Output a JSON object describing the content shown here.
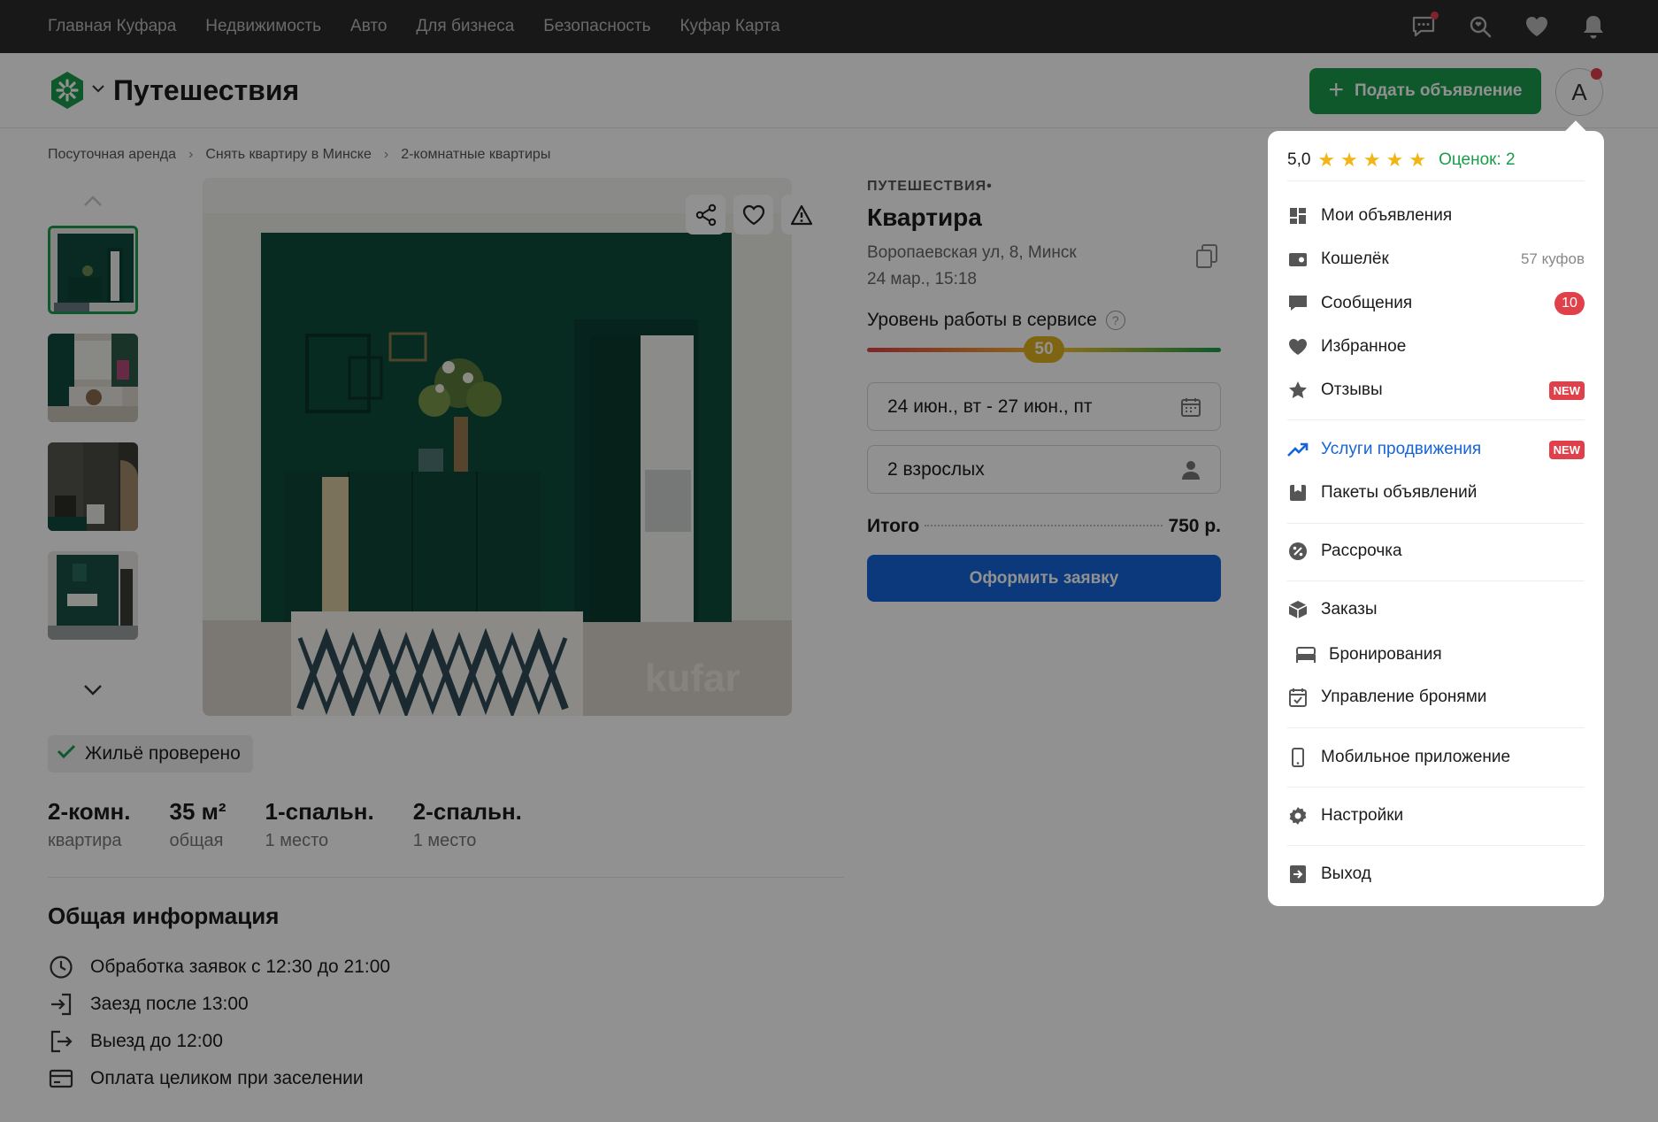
{
  "topnav": {
    "links": [
      "Главная Куфара",
      "Недвижимость",
      "Авто",
      "Для бизнеса",
      "Безопасность",
      "Куфар Карта"
    ],
    "icons": [
      "messages-icon",
      "saved-search-icon",
      "heart-icon",
      "bell-icon"
    ]
  },
  "header": {
    "section_title": "Путешествия",
    "post_button": "Подать объявление",
    "avatar_letter": "А"
  },
  "breadcrumb": [
    "Посуточная аренда",
    "Снять квартиру в Минске",
    "2-комнатные квартиры"
  ],
  "gallery": {
    "thumbnail_count": 4,
    "watermark": "kufar"
  },
  "verified_label": "Жильё проверено",
  "specs": [
    {
      "value": "2-комн.",
      "label": "квартира"
    },
    {
      "value": "35 м²",
      "label": "общая"
    },
    {
      "value": "1-спальн.",
      "label": "1 место"
    },
    {
      "value": "2-спальн.",
      "label": "1 место"
    }
  ],
  "general_info": {
    "title": "Общая информация",
    "rows": [
      "Обработка заявок с 12:30 до 21:00",
      "Заезд после 13:00",
      "Выезд до 12:00",
      "Оплата целиком при заселении"
    ]
  },
  "listing": {
    "category": "ПУТЕШЕСТВИЯ•",
    "title": "Квартира",
    "address": "Воропаевская ул, 8, Минск",
    "date": "24 мар., 15:18",
    "service_level_label": "Уровень работы в сервисе",
    "service_level_value": "50",
    "service_level_fraction": 0.5,
    "dates_field": "24 июн., вт - 27 июн., пт",
    "guests_field": "2 взрослых",
    "total_label": "Итого",
    "total_value": "750 р.",
    "order_button": "Оформить заявку"
  },
  "menu": {
    "rating_value": "5,0",
    "stars": 5,
    "rating_count": "Оценок: 2",
    "items": [
      {
        "label": "Мои объявления",
        "icon": "dashboard-icon"
      },
      {
        "label": "Кошелёк",
        "icon": "wallet-icon",
        "right": "57 куфов"
      },
      {
        "label": "Сообщения",
        "icon": "chat-icon",
        "badge": "10"
      },
      {
        "label": "Избранное",
        "icon": "heart-icon"
      },
      {
        "label": "Отзывы",
        "icon": "star-icon",
        "new": "NEW"
      },
      {
        "label": "Услуги продвижения",
        "icon": "trend-up-icon",
        "new": "NEW"
      },
      {
        "label": "Пакеты объявлений",
        "icon": "package-icon"
      },
      {
        "label": "Рассрочка",
        "icon": "percent-icon"
      },
      {
        "label": "Заказы",
        "icon": "box-icon"
      },
      {
        "label": "Бронирования",
        "icon": "bed-icon"
      },
      {
        "label": "Управление бронями",
        "icon": "calendar-check-icon"
      },
      {
        "label": "Мобильное приложение",
        "icon": "phone-icon"
      },
      {
        "label": "Настройки",
        "icon": "gear-icon"
      },
      {
        "label": "Выход",
        "icon": "logout-icon"
      }
    ]
  },
  "colors": {
    "brand_green": "#1a9c4c",
    "action_blue": "#1565d8",
    "badge_red": "#e0404a",
    "star_yellow": "#f2b515",
    "topnav_bg": "#2b2b2b"
  }
}
